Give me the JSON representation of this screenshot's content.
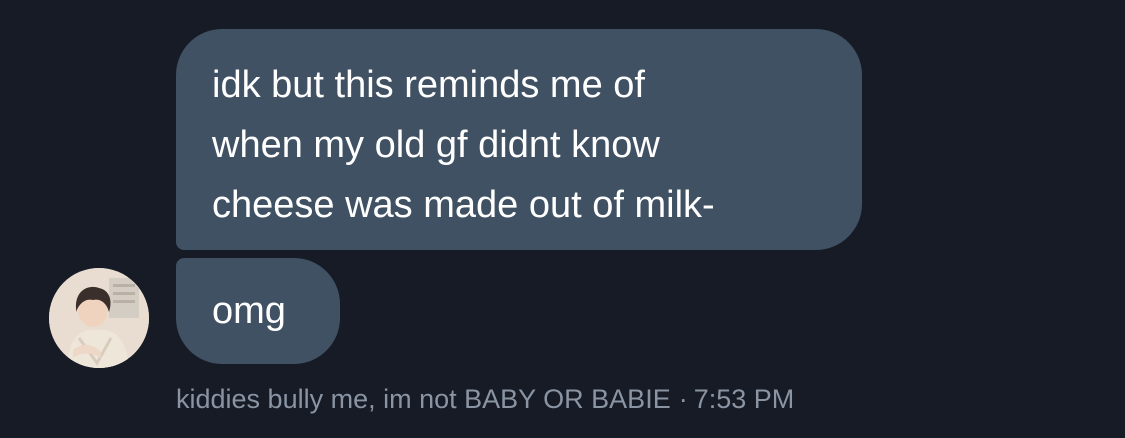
{
  "messages": [
    {
      "lines": [
        "idk but this reminds me of",
        "when my old gf didnt know",
        "cheese was made out of milk-"
      ]
    },
    {
      "lines": [
        "omg"
      ]
    }
  ],
  "sender": {
    "name": "kiddies bully me, im not BABY OR BABIE",
    "separator": "·",
    "time": "7:53 PM"
  },
  "colors": {
    "background": "#161b26",
    "bubble": "#3f5163",
    "bubble_text": "#ffffff",
    "meta_text": "#8a94a3"
  },
  "icons": {
    "avatar": "profile-photo"
  }
}
